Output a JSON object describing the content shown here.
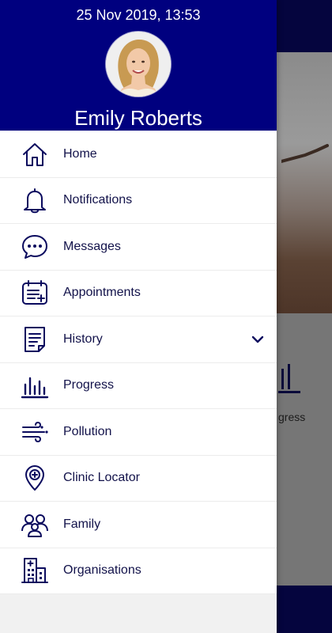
{
  "status": {
    "datetime": "25 Nov 2019, 13:53"
  },
  "user": {
    "name": "Emily Roberts"
  },
  "menu": {
    "items": [
      {
        "label": "Home",
        "icon": "home-icon"
      },
      {
        "label": "Notifications",
        "icon": "bell-icon"
      },
      {
        "label": "Messages",
        "icon": "chat-icon"
      },
      {
        "label": "Appointments",
        "icon": "calendar-add-icon"
      },
      {
        "label": "History",
        "icon": "document-icon",
        "expandable": true
      },
      {
        "label": "Progress",
        "icon": "bar-chart-icon"
      },
      {
        "label": "Pollution",
        "icon": "wind-icon"
      },
      {
        "label": "Clinic Locator",
        "icon": "location-pin-icon"
      },
      {
        "label": "Family",
        "icon": "family-icon"
      },
      {
        "label": "Organisations",
        "icon": "building-icon"
      }
    ]
  },
  "background": {
    "progress_label": "gress"
  },
  "colors": {
    "header": "#00007f",
    "icon": "#0a0a5e",
    "topbar": "#05053e"
  }
}
